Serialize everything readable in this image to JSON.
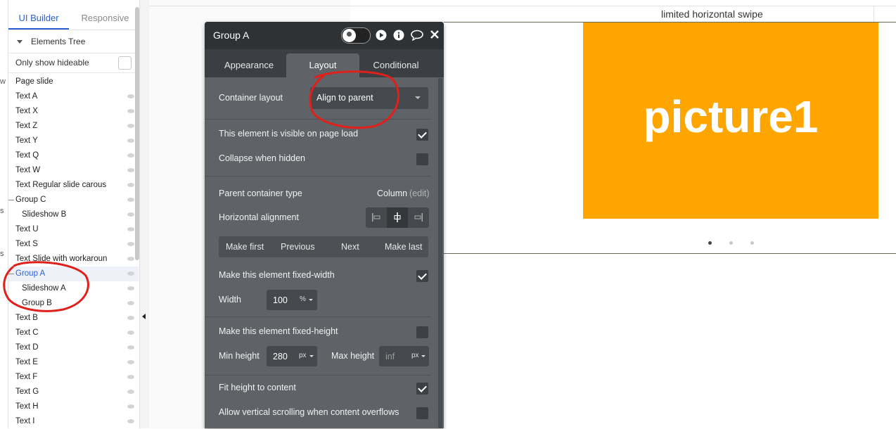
{
  "left_strip": {
    "fragments": [
      "w",
      "s",
      "s"
    ]
  },
  "sidebar": {
    "tabs": [
      {
        "label": "UI Builder"
      },
      {
        "label": "Responsive"
      }
    ],
    "tree_header": "Elements Tree",
    "only_hideable_label": "Only show hideable",
    "items": [
      {
        "label": "Page slide",
        "indent": 0,
        "eye": false
      },
      {
        "label": "Text A",
        "indent": 0,
        "eye": true
      },
      {
        "label": "Text X",
        "indent": 0,
        "eye": true
      },
      {
        "label": "Text Z",
        "indent": 0,
        "eye": true
      },
      {
        "label": "Text Y",
        "indent": 0,
        "eye": true
      },
      {
        "label": "Text Q",
        "indent": 0,
        "eye": true
      },
      {
        "label": "Text W",
        "indent": 0,
        "eye": true
      },
      {
        "label": "Text Regular slide carous",
        "indent": 0,
        "eye": true
      },
      {
        "label": "Group C",
        "indent": 0,
        "eye": true,
        "group": true
      },
      {
        "label": "Slideshow B",
        "indent": 1,
        "eye": true
      },
      {
        "label": "Text U",
        "indent": 0,
        "eye": true
      },
      {
        "label": "Text S",
        "indent": 0,
        "eye": true
      },
      {
        "label": "Text Slide with workaroun",
        "indent": 0,
        "eye": true
      },
      {
        "label": "Group A",
        "indent": 0,
        "eye": true,
        "group": true,
        "selected": true
      },
      {
        "label": "Slideshow A",
        "indent": 1,
        "eye": true
      },
      {
        "label": "Group B",
        "indent": 1,
        "eye": true
      },
      {
        "label": "Text B",
        "indent": 0,
        "eye": true
      },
      {
        "label": "Text C",
        "indent": 0,
        "eye": true
      },
      {
        "label": "Text D",
        "indent": 0,
        "eye": true
      },
      {
        "label": "Text E",
        "indent": 0,
        "eye": true
      },
      {
        "label": "Text F",
        "indent": 0,
        "eye": true
      },
      {
        "label": "Text G",
        "indent": 0,
        "eye": true
      },
      {
        "label": "Text H",
        "indent": 0,
        "eye": true
      },
      {
        "label": "Text I",
        "indent": 0,
        "eye": true
      }
    ]
  },
  "canvas": {
    "title": "limited horizontal swipe",
    "picture_text": "picture1",
    "picture_color": "#FFA500",
    "dots": [
      {
        "active": true
      },
      {
        "active": false
      },
      {
        "active": false
      }
    ]
  },
  "panel": {
    "title": "Group A",
    "header_icons": [
      "user-icon",
      "play-icon",
      "info-icon",
      "comment-icon",
      "close-icon"
    ],
    "tabs": [
      {
        "label": "Appearance"
      },
      {
        "label": "Layout"
      },
      {
        "label": "Conditional"
      }
    ],
    "active_tab": "Layout",
    "container_layout_label": "Container layout",
    "container_layout_value": "Align to parent",
    "visible_on_load_label": "This element is visible on page load",
    "visible_on_load": true,
    "collapse_hidden_label": "Collapse when hidden",
    "collapse_hidden": false,
    "parent_type_label": "Parent container type",
    "parent_type_value": "Column",
    "parent_type_edit": "(edit)",
    "h_align_label": "Horizontal alignment",
    "h_align_options": [
      "align-left-icon",
      "align-center-icon",
      "align-right-icon"
    ],
    "h_align_selected": "align-center-icon",
    "nav": {
      "first": "Make first",
      "previous": "Previous",
      "next": "Next",
      "last": "Make last"
    },
    "fixed_width_label": "Make this element fixed-width",
    "fixed_width": true,
    "width_label": "Width",
    "width_value": "100",
    "width_unit": "%",
    "fixed_height_label": "Make this element fixed-height",
    "fixed_height": false,
    "min_height_label": "Min height",
    "min_height_value": "280",
    "min_height_unit": "px",
    "max_height_label": "Max height",
    "max_height_placeholder": "inf",
    "max_height_unit": "px",
    "fit_height_label": "Fit height to content",
    "fit_height": true,
    "vscroll_label": "Allow vertical scrolling when content overflows",
    "vscroll": false
  },
  "colors": {
    "accent": "#2D5FD3",
    "panel_bg": "#5F6266",
    "panel_header": "#2F3235",
    "annotation": "#E0201B"
  }
}
